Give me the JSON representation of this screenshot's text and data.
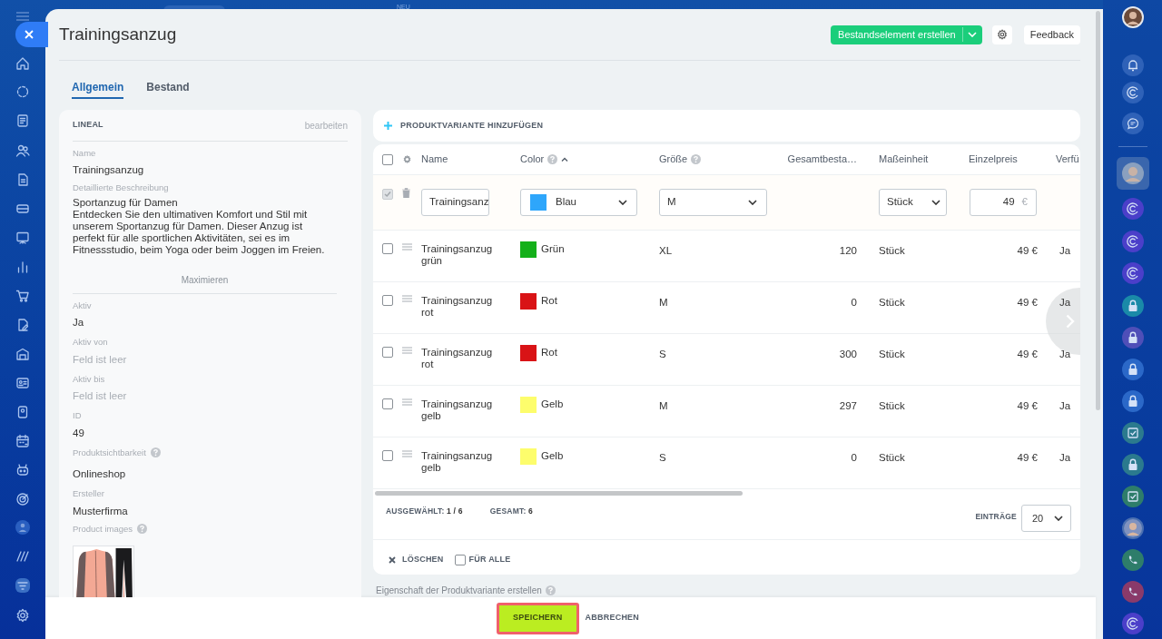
{
  "top_bar": {
    "badge": "NEU"
  },
  "panel": {
    "title": "Trainingsanzug",
    "create_button": "Bestandselement erstellen",
    "feedback_button": "Feedback"
  },
  "tabs": [
    {
      "label": "Allgemein",
      "selected": true
    },
    {
      "label": "Bestand",
      "selected": false
    }
  ],
  "details": {
    "section": "LINEAL",
    "edit_link": "bearbeiten",
    "expand_link": "Maximieren",
    "fields": [
      {
        "kind": "value",
        "label": "Name",
        "value": "Trainingsanzug"
      },
      {
        "kind": "description",
        "label": "Detaillierte Beschreibung",
        "title": "Sportanzug für Damen",
        "value": "Entdecken Sie den ultimativen Komfort und Stil mit unserem Sportanzug für Damen. Dieser Anzug ist perfekt für alle sportlichen Aktivitäten, sei es im Fitnessstudio, beim Yoga oder beim Joggen im Freien."
      },
      {
        "kind": "value",
        "label": "Aktiv",
        "value": "Ja"
      },
      {
        "kind": "value",
        "label": "Aktiv von",
        "value": "Feld ist leer",
        "empty": true
      },
      {
        "kind": "value",
        "label": "Aktiv bis",
        "value": "Feld ist leer",
        "empty": true
      },
      {
        "kind": "value",
        "label": "ID",
        "value": "49"
      },
      {
        "kind": "value",
        "label": "Produktsichtbarkeit",
        "value": "Onlineshop",
        "help": true
      },
      {
        "kind": "value",
        "label": "Ersteller",
        "value": "Musterfirma"
      },
      {
        "kind": "images",
        "label": "Product images",
        "help": true
      }
    ]
  },
  "variants": {
    "add_button": "PRODUKTVARIANTE HINZUFÜGEN",
    "columns": [
      {
        "label": "Name"
      },
      {
        "label": "Color",
        "help": true,
        "sorted": true
      },
      {
        "label": "Größe",
        "help": true
      },
      {
        "label": "Gesamtbesta…"
      },
      {
        "label": "Maßeinheit"
      },
      {
        "label": "Einzelpreis"
      },
      {
        "label": "Verfü"
      }
    ],
    "header_checked": false,
    "edit_row": {
      "checked": true,
      "name": "Trainingsanz",
      "color_label": "Blau",
      "color": "#2ea6fb",
      "size": "M",
      "unit": "Stück",
      "price": "49",
      "currency": "€"
    },
    "rows": [
      {
        "checked": false,
        "name": "Trainingsanzug grün",
        "color_label": "Grün",
        "color": "#14b01a",
        "size": "XL",
        "stock": "120",
        "unit": "Stück",
        "price": "49 €",
        "available": "Ja"
      },
      {
        "checked": false,
        "name": "Trainingsanzug rot",
        "color_label": "Rot",
        "color": "#d91316",
        "size": "M",
        "stock": "0",
        "unit": "Stück",
        "price": "49 €",
        "available": "Ja"
      },
      {
        "checked": false,
        "name": "Trainingsanzug rot",
        "color_label": "Rot",
        "color": "#d91316",
        "size": "S",
        "stock": "300",
        "unit": "Stück",
        "price": "49 €",
        "available": "Ja"
      },
      {
        "checked": false,
        "name": "Trainingsanzug gelb",
        "color_label": "Gelb",
        "color": "#fdfd6c",
        "size": "M",
        "stock": "297",
        "unit": "Stück",
        "price": "49 €",
        "available": "Ja"
      },
      {
        "checked": false,
        "name": "Trainingsanzug gelb",
        "color_label": "Gelb",
        "color": "#fdfd6c",
        "size": "S",
        "stock": "0",
        "unit": "Stück",
        "price": "49 €",
        "available": "Ja"
      }
    ],
    "selected_label": "AUSGEWÄHLT:",
    "selected_value": "1 / 6",
    "total_label": "GESAMT:",
    "total_value": "6",
    "page_size_label": "EINTRÄGE",
    "page_size": "20",
    "delete_button": "LÖSCHEN",
    "for_all": {
      "label": "FÜR ALLE",
      "checked": false
    }
  },
  "footnote": {
    "text": "Eigenschaft der Produktvariante erstellen",
    "help": true
  },
  "footer": {
    "save_button": "SPEICHERN",
    "cancel_button": "ABBRECHEN"
  }
}
